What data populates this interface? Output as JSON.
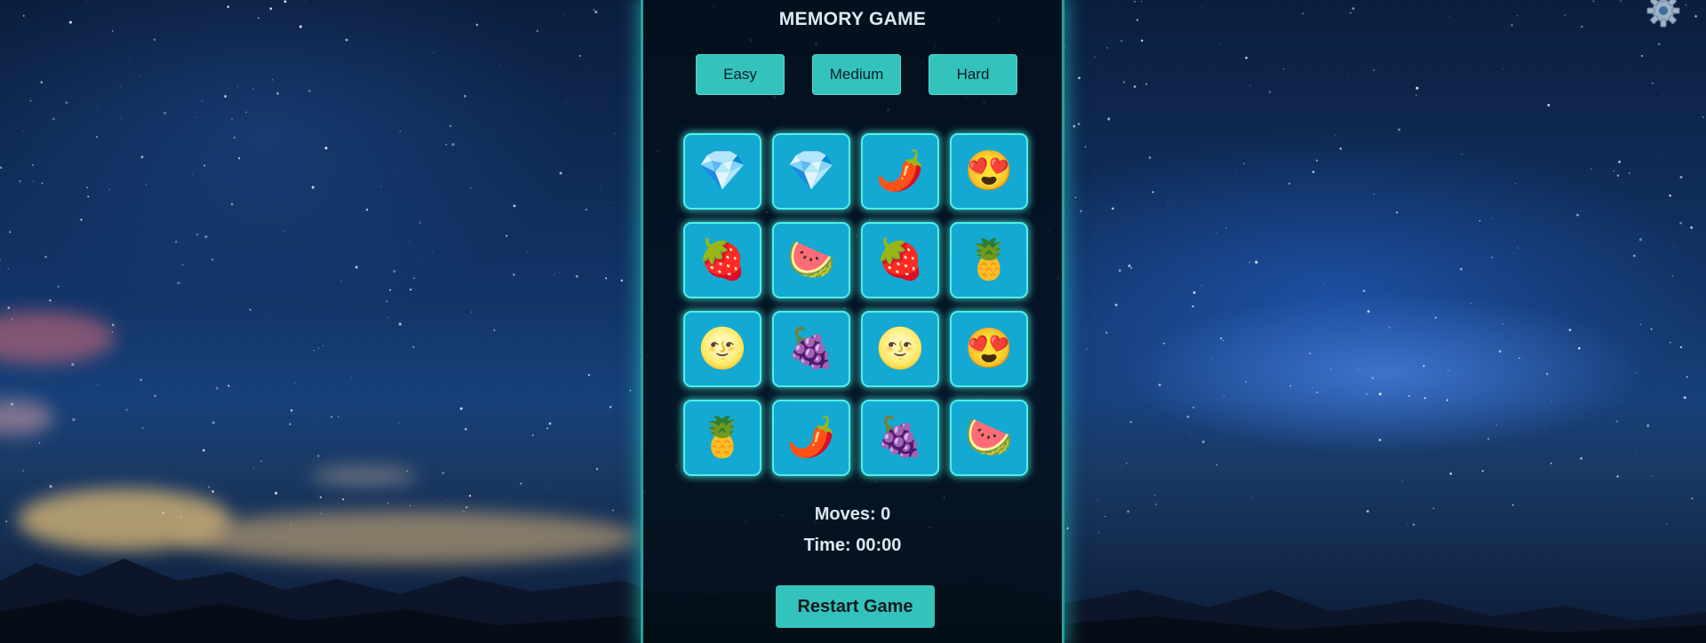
{
  "title": "MEMORY GAME",
  "difficulty": {
    "easy": "Easy",
    "medium": "Medium",
    "hard": "Hard"
  },
  "board": {
    "rows": [
      [
        "💎",
        "💎",
        "🌶️",
        "😍"
      ],
      [
        "🍓",
        "🍉",
        "🍓",
        "🍍"
      ],
      [
        "🌝",
        "🍇",
        "🌝",
        "😍"
      ],
      [
        "🍍",
        "🌶️",
        "🍇",
        "🍉"
      ]
    ],
    "card_icons": [
      [
        "diamond-icon",
        "diamond-icon",
        "chili-pepper-icon",
        "heart-eyes-icon"
      ],
      [
        "strawberry-icon",
        "watermelon-icon",
        "strawberry-icon",
        "pineapple-icon"
      ],
      [
        "moon-face-icon",
        "grapes-icon",
        "moon-face-icon",
        "heart-eyes-icon"
      ],
      [
        "pineapple-icon",
        "chili-pepper-icon",
        "grapes-icon",
        "watermelon-icon"
      ]
    ]
  },
  "stats": {
    "moves": "Moves: 0",
    "time": "Time: 00:00"
  },
  "restart_label": "Restart Game",
  "colors": {
    "accent": "#34c2bd",
    "card": "#14a9d2",
    "card_glow": "#4cf0ec",
    "panel": "#020e18"
  }
}
